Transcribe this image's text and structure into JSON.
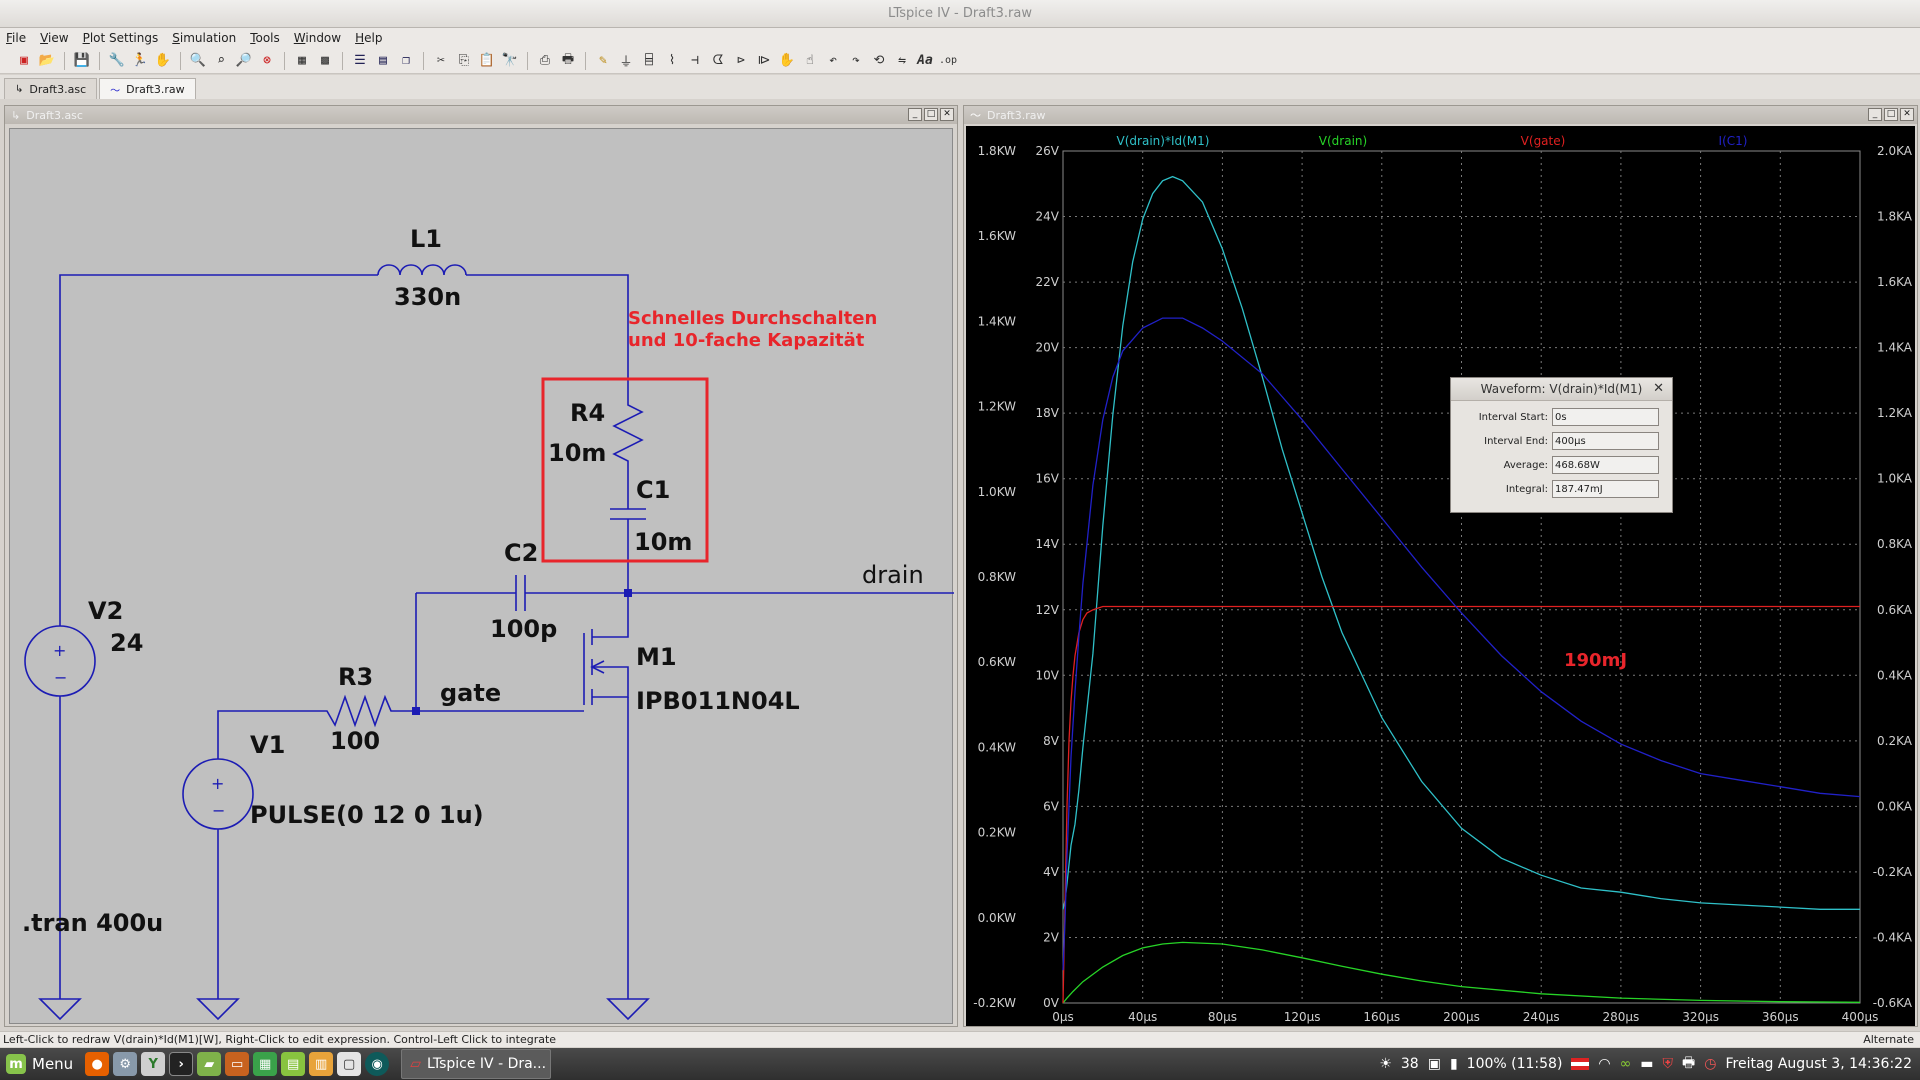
{
  "window": {
    "title": "LTspice IV - Draft3.raw"
  },
  "menu": [
    "File",
    "View",
    "Plot Settings",
    "Simulation",
    "Tools",
    "Window",
    "Help"
  ],
  "toolbar_icons": [
    "new-schematic-icon",
    "open-icon",
    "save-icon",
    "control-panel-icon",
    "run-icon",
    "halt-icon",
    "zoom-in-icon",
    "zoom-box-icon",
    "zoom-out-icon",
    "zoom-cancel-icon",
    "autorange-icon",
    "grid-icon",
    "tile-horizontal-icon",
    "tile-vertical-icon",
    "cascade-icon",
    "cut-icon",
    "copy-icon",
    "paste-icon",
    "find-icon",
    "print-preview-icon",
    "print-icon",
    "wire-icon",
    "ground-icon",
    "label-icon",
    "resistor-icon",
    "capacitor-icon",
    "inductor-icon",
    "diode-icon",
    "component-icon",
    "move-icon",
    "drag-icon",
    "undo-icon",
    "redo-icon",
    "rotate-icon",
    "mirror-icon",
    "text-icon",
    "spice-directive-icon"
  ],
  "tabs": [
    {
      "label": "Draft3.asc",
      "icon": "schematic-tab-icon",
      "active": false
    },
    {
      "label": "Draft3.raw",
      "icon": "waveform-tab-icon",
      "active": true
    }
  ],
  "schematic": {
    "title": "Draft3.asc",
    "labels": {
      "L1": "L1",
      "L1_val": "330n",
      "note1": "Schnelles Durchschalten",
      "note2": "und 10-fache Kapazität",
      "R4": "R4",
      "R4_val": "10m",
      "C1": "C1",
      "C1_val": "10m",
      "C2": "C2",
      "C2_val": "100p",
      "drain": "drain",
      "gate": "gate",
      "V2": "V2",
      "V2_val": "24",
      "R3": "R3",
      "R3_val": "100",
      "M1": "M1",
      "M1_val": "IPB011N04L",
      "V1": "V1",
      "V1_val": "PULSE(0 12 0 1u)",
      "tran": ".tran 400u",
      "plus": "+",
      "minus": "−"
    },
    "wire_color": "#1c1cb4",
    "note_color": "#e8252b"
  },
  "plot": {
    "title": "Draft3.raw",
    "annotation": "190mJ",
    "annotation_color": "#e8252b"
  },
  "chart_data": {
    "type": "line",
    "x_ticks": [
      "0µs",
      "40µs",
      "80µs",
      "120µs",
      "160µs",
      "200µs",
      "240µs",
      "280µs",
      "320µs",
      "360µs",
      "400µs"
    ],
    "xlim": [
      0,
      400
    ],
    "y_left_power_ticks": [
      "1.8KW",
      "1.6KW",
      "1.4KW",
      "1.2KW",
      "1.0KW",
      "0.8KW",
      "0.6KW",
      "0.4KW",
      "0.2KW",
      "0.0KW",
      "-0.2KW"
    ],
    "y_left_power_lim": [
      -0.2,
      1.8
    ],
    "y_left_voltage_ticks": [
      "26V",
      "24V",
      "22V",
      "20V",
      "18V",
      "16V",
      "14V",
      "12V",
      "10V",
      "8V",
      "6V",
      "4V",
      "2V",
      "0V"
    ],
    "y_left_voltage_lim": [
      0,
      26
    ],
    "y_right_current_ticks": [
      "2.0KA",
      "1.8KA",
      "1.6KA",
      "1.4KA",
      "1.2KA",
      "1.0KA",
      "0.8KA",
      "0.6KA",
      "0.4KA",
      "0.2KA",
      "0.0KA",
      "-0.2KA",
      "-0.4KA",
      "-0.6KA"
    ],
    "y_right_current_lim": [
      -0.6,
      2.0
    ],
    "grid": true,
    "legend_placement": "top",
    "series": [
      {
        "name": "V(drain)*Id(M1)",
        "color": "#2fc0c8",
        "axis": "power",
        "x": [
          0,
          1,
          2,
          4,
          6,
          8,
          10,
          15,
          20,
          25,
          30,
          35,
          40,
          45,
          50,
          55,
          60,
          70,
          80,
          90,
          100,
          110,
          120,
          130,
          140,
          160,
          180,
          200,
          220,
          240,
          260,
          280,
          300,
          320,
          340,
          360,
          380,
          400
        ],
        "y": [
          0.02,
          0.04,
          0.08,
          0.17,
          0.22,
          0.3,
          0.4,
          0.62,
          0.92,
          1.18,
          1.39,
          1.54,
          1.64,
          1.7,
          1.73,
          1.74,
          1.73,
          1.68,
          1.57,
          1.43,
          1.27,
          1.1,
          0.95,
          0.8,
          0.67,
          0.47,
          0.32,
          0.21,
          0.14,
          0.1,
          0.07,
          0.06,
          0.045,
          0.035,
          0.03,
          0.025,
          0.02,
          0.02
        ]
      },
      {
        "name": "V(drain)",
        "color": "#27d327",
        "axis": "voltage",
        "x": [
          0,
          2,
          5,
          10,
          20,
          30,
          40,
          50,
          60,
          80,
          100,
          120,
          140,
          160,
          180,
          200,
          240,
          280,
          320,
          360,
          400
        ],
        "y": [
          0.0,
          0.15,
          0.35,
          0.65,
          1.1,
          1.45,
          1.68,
          1.8,
          1.85,
          1.8,
          1.62,
          1.38,
          1.12,
          0.88,
          0.67,
          0.5,
          0.28,
          0.15,
          0.08,
          0.04,
          0.02
        ]
      },
      {
        "name": "V(gate)",
        "color": "#e02020",
        "axis": "voltage",
        "x": [
          0,
          1,
          2,
          3,
          4,
          5,
          6,
          8,
          10,
          12,
          15,
          20,
          30,
          400
        ],
        "y": [
          0,
          3.0,
          6.0,
          8.0,
          9.2,
          10.0,
          10.6,
          11.3,
          11.7,
          11.9,
          12.0,
          12.1,
          12.1,
          12.1
        ]
      },
      {
        "name": "I(C1)",
        "color": "#2121c8",
        "axis": "current",
        "x": [
          0,
          1,
          2,
          4,
          6,
          8,
          10,
          15,
          20,
          25,
          30,
          40,
          50,
          60,
          70,
          80,
          100,
          120,
          140,
          160,
          180,
          200,
          220,
          240,
          260,
          280,
          300,
          320,
          340,
          360,
          380,
          400
        ],
        "y": [
          -0.5,
          -0.35,
          -0.15,
          0.15,
          0.35,
          0.52,
          0.68,
          0.98,
          1.18,
          1.31,
          1.39,
          1.46,
          1.49,
          1.49,
          1.46,
          1.42,
          1.32,
          1.18,
          1.03,
          0.88,
          0.73,
          0.59,
          0.46,
          0.35,
          0.26,
          0.19,
          0.14,
          0.1,
          0.08,
          0.06,
          0.04,
          0.03
        ]
      }
    ]
  },
  "dialog": {
    "title": "Waveform: V(drain)*Id(M1)",
    "fields": [
      {
        "label": "Interval Start:",
        "value": "0s"
      },
      {
        "label": "Interval End:",
        "value": "400µs"
      },
      {
        "label": "Average:",
        "value": "468.68W"
      },
      {
        "label": "Integral:",
        "value": "187.47mJ"
      }
    ]
  },
  "status": {
    "text": "Left-Click to redraw V(drain)*Id(M1)[W],  Right-Click to edit expression. Control-Left Click to integrate",
    "right": "Alternate"
  },
  "taskbar": {
    "menu_label": "Menu",
    "task_label": "LTspice IV - Dra...",
    "temp": "38",
    "battery": "100% (11:58)",
    "clock": "Freitag August  3, 14:36:22"
  }
}
